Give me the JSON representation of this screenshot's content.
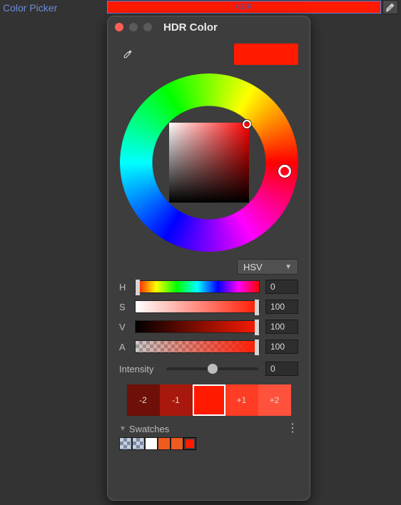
{
  "topbar": {
    "label": "Color Picker",
    "swatch_text": "HDR",
    "swatch_color": "#ff1a00"
  },
  "panel": {
    "title": "HDR Color",
    "current_color": "#ff1a00"
  },
  "mode": {
    "selected": "HSV"
  },
  "sliders": {
    "h": {
      "label": "H",
      "value": "0"
    },
    "s": {
      "label": "S",
      "value": "100"
    },
    "v": {
      "label": "V",
      "value": "100"
    },
    "a": {
      "label": "A",
      "value": "100"
    }
  },
  "intensity": {
    "label": "Intensity",
    "value": "0"
  },
  "intensity_swatches": {
    "items": [
      {
        "label": "-2",
        "color": "#6e0f08"
      },
      {
        "label": "-1",
        "color": "#a8180c"
      },
      {
        "label": "",
        "color": "#ff1a00"
      },
      {
        "label": "+1",
        "color": "#ff3c24"
      },
      {
        "label": "+2",
        "color": "#ff523d"
      }
    ]
  },
  "swatches": {
    "header": "Swatches"
  }
}
